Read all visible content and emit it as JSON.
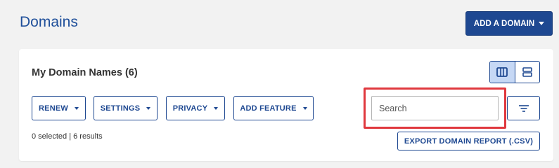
{
  "header": {
    "title": "Domains",
    "add_domain_label": "ADD A DOMAIN"
  },
  "card": {
    "title": "My Domain Names (6)",
    "view_toggle": [
      {
        "icon": "columns-icon",
        "active": true
      },
      {
        "icon": "rows-icon",
        "active": false
      }
    ],
    "filters": [
      {
        "label": "RENEW"
      },
      {
        "label": "SETTINGS"
      },
      {
        "label": "PRIVACY"
      },
      {
        "label": "ADD FEATURE"
      }
    ],
    "search": {
      "placeholder": "Search",
      "value": ""
    },
    "filter_icon": "filter-lines-icon",
    "results_text": "0 selected | 6 results",
    "export_label": "EXPORT DOMAIN REPORT (.CSV)"
  },
  "colors": {
    "brand": "#1e4891",
    "title": "#1f4f9a",
    "highlight": "#e0383e",
    "active_toggle": "#c6d8f5"
  }
}
